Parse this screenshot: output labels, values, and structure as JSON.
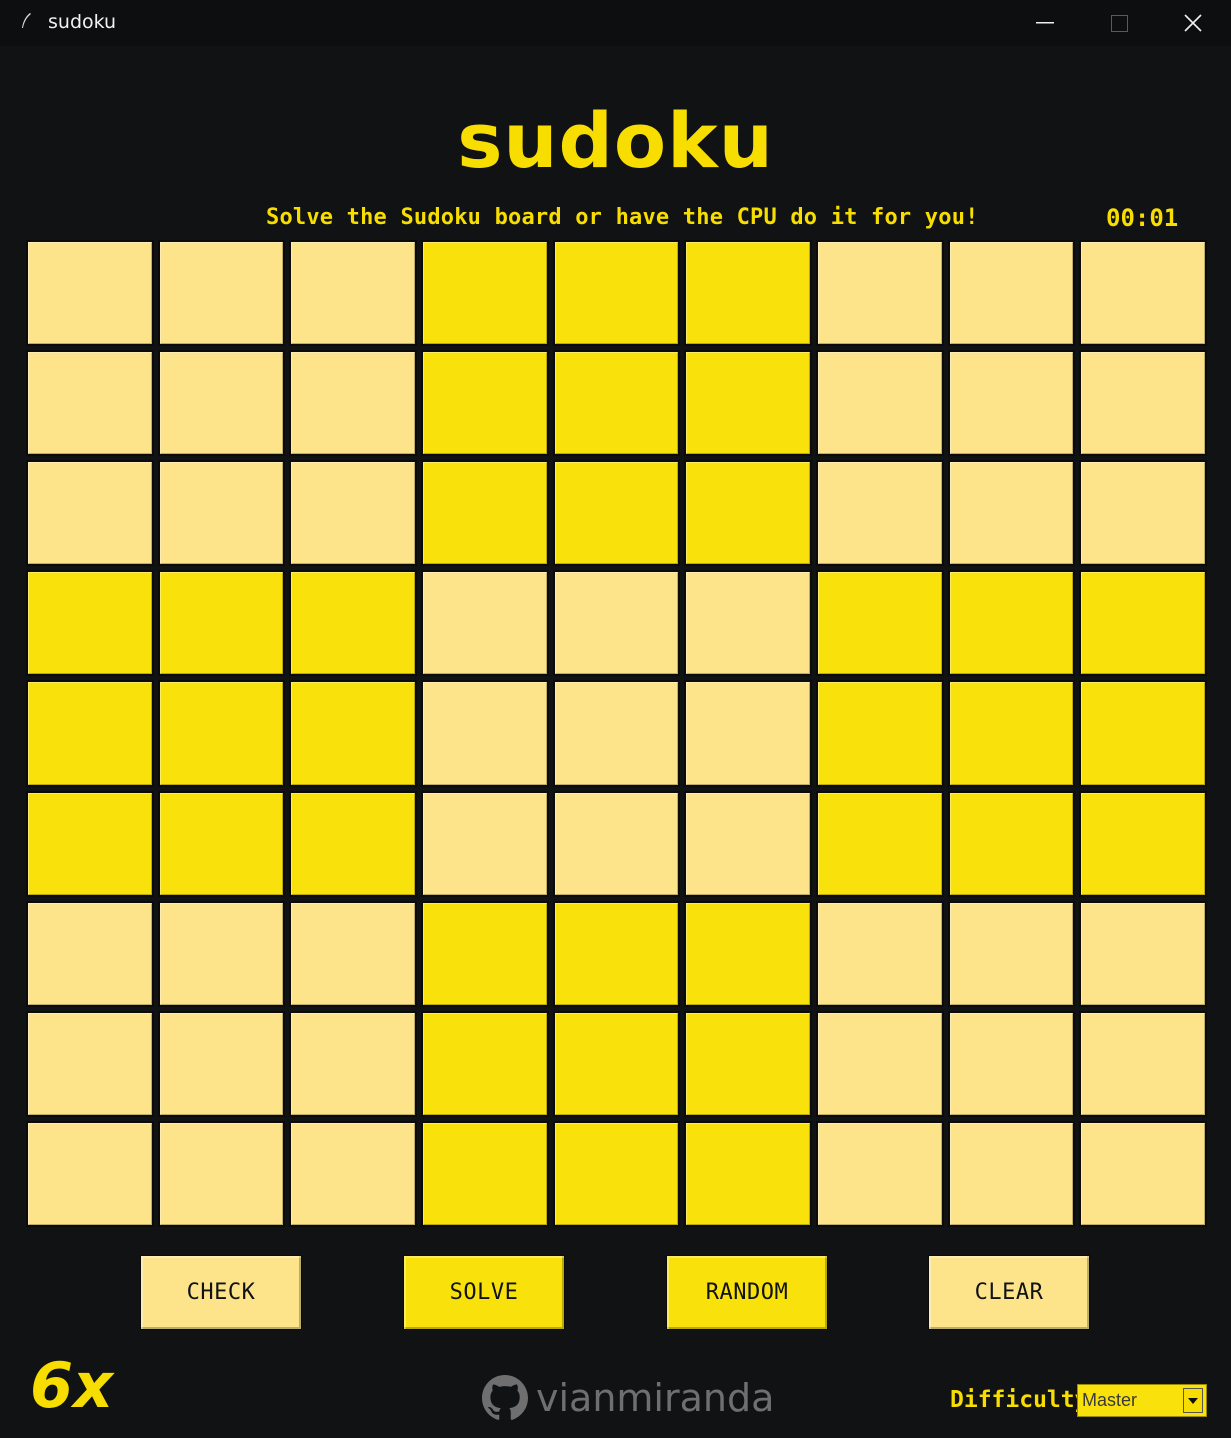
{
  "window": {
    "title": "sudoku"
  },
  "header": {
    "title": "sudoku",
    "subtitle": "Solve the Sudoku board or have the CPU do it for you!",
    "timer": "00:01"
  },
  "colors": {
    "background": "#101214",
    "accent": "#f7dd00",
    "cell_light": "#fde48b",
    "cell_dark": "#f9e10b",
    "button_light": "#fde48b",
    "button_dark": "#f9e10b",
    "select_bg": "#f9e10b"
  },
  "board": {
    "rows": [
      [
        "",
        "",
        "",
        "",
        "",
        "",
        "",
        "",
        ""
      ],
      [
        "",
        "",
        "",
        "",
        "",
        "",
        "",
        "",
        ""
      ],
      [
        "",
        "",
        "",
        "",
        "",
        "",
        "",
        "",
        ""
      ],
      [
        "",
        "",
        "",
        "",
        "",
        "",
        "",
        "",
        ""
      ],
      [
        "",
        "",
        "",
        "",
        "",
        "",
        "",
        "",
        ""
      ],
      [
        "",
        "",
        "",
        "",
        "",
        "",
        "",
        "",
        ""
      ],
      [
        "",
        "",
        "",
        "",
        "",
        "",
        "",
        "",
        ""
      ],
      [
        "",
        "",
        "",
        "",
        "",
        "",
        "",
        "",
        ""
      ],
      [
        "",
        "",
        "",
        "",
        "",
        "",
        "",
        "",
        ""
      ]
    ],
    "shading": [
      [
        "light",
        "light",
        "light",
        "dark",
        "dark",
        "dark",
        "light",
        "light",
        "light"
      ],
      [
        "light",
        "light",
        "light",
        "dark",
        "dark",
        "dark",
        "light",
        "light",
        "light"
      ],
      [
        "light",
        "light",
        "light",
        "dark",
        "dark",
        "dark",
        "light",
        "light",
        "light"
      ],
      [
        "dark",
        "dark",
        "dark",
        "light",
        "light",
        "light",
        "dark",
        "dark",
        "dark"
      ],
      [
        "dark",
        "dark",
        "dark",
        "light",
        "light",
        "light",
        "dark",
        "dark",
        "dark"
      ],
      [
        "dark",
        "dark",
        "dark",
        "light",
        "light",
        "light",
        "dark",
        "dark",
        "dark"
      ],
      [
        "light",
        "light",
        "light",
        "dark",
        "dark",
        "dark",
        "light",
        "light",
        "light"
      ],
      [
        "light",
        "light",
        "light",
        "dark",
        "dark",
        "dark",
        "light",
        "light",
        "light"
      ],
      [
        "light",
        "light",
        "light",
        "dark",
        "dark",
        "dark",
        "light",
        "light",
        "light"
      ]
    ]
  },
  "buttons": {
    "check": "CHECK",
    "solve": "SOLVE",
    "random": "RANDOM",
    "clear": "CLEAR"
  },
  "footer": {
    "speed": "6x",
    "github_username": "vianmiranda",
    "github_icon": "github-icon",
    "difficulty_label": "Difficulty:",
    "difficulty_value": "Master"
  }
}
